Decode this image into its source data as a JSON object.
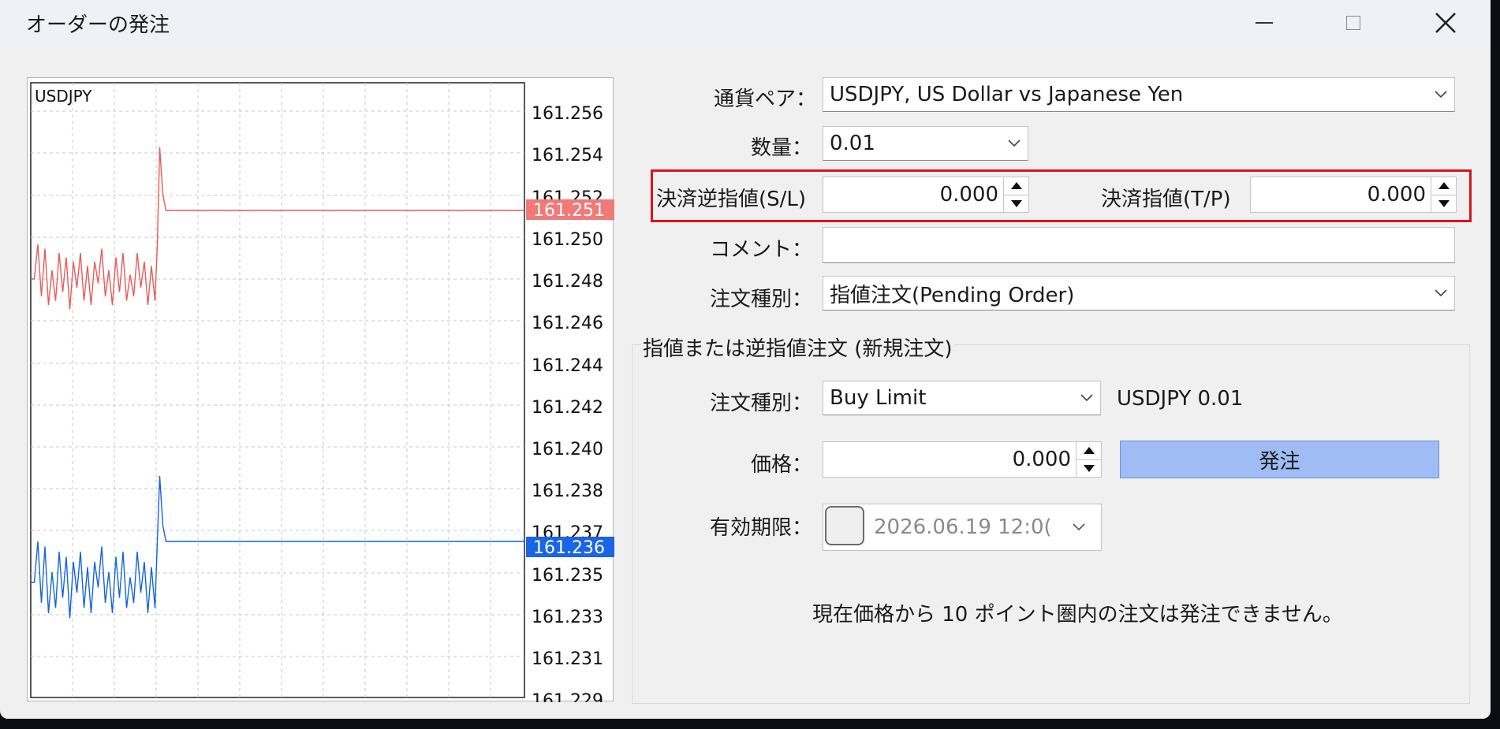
{
  "window": {
    "title": "オーダーの発注"
  },
  "chart": {
    "symbol": "USDJPY",
    "price_labels": [
      "161.256",
      "161.254",
      "161.252",
      "161.250",
      "161.248",
      "161.246",
      "161.244",
      "161.242",
      "161.240",
      "161.238",
      "161.237",
      "161.235",
      "161.233",
      "161.231",
      "161.229"
    ],
    "bid_tag": "161.251",
    "ask_tag": "161.236",
    "colors": {
      "bid": "#e85a5a",
      "ask": "#1464dc",
      "bid_tag_bg": "#f07a78",
      "ask_tag_bg": "#1a64e6"
    }
  },
  "form": {
    "symbol_label": "通貨ペア：",
    "symbol_value": "USDJPY, US Dollar vs Japanese Yen",
    "volume_label": "数量：",
    "volume_value": "0.01",
    "sl_label": "決済逆指値(S/L)",
    "sl_value": "0.000",
    "tp_label": "決済指値(T/P)",
    "tp_value": "0.000",
    "comment_label": "コメント：",
    "comment_value": "",
    "type_label": "注文種別：",
    "type_value": "指値注文(Pending Order)"
  },
  "pending": {
    "group_title": "指値または逆指値注文 (新規注文)",
    "order_type_label": "注文種別：",
    "order_type_value": "Buy Limit",
    "summary": "USDJPY 0.01",
    "price_label": "価格：",
    "price_value": "0.000",
    "submit_label": "発注",
    "expiry_label": "有効期限：",
    "expiry_value": "2026.06.19 12:0(",
    "notice": "現在価格から 10 ポイント圏内の注文は発注できません。"
  }
}
